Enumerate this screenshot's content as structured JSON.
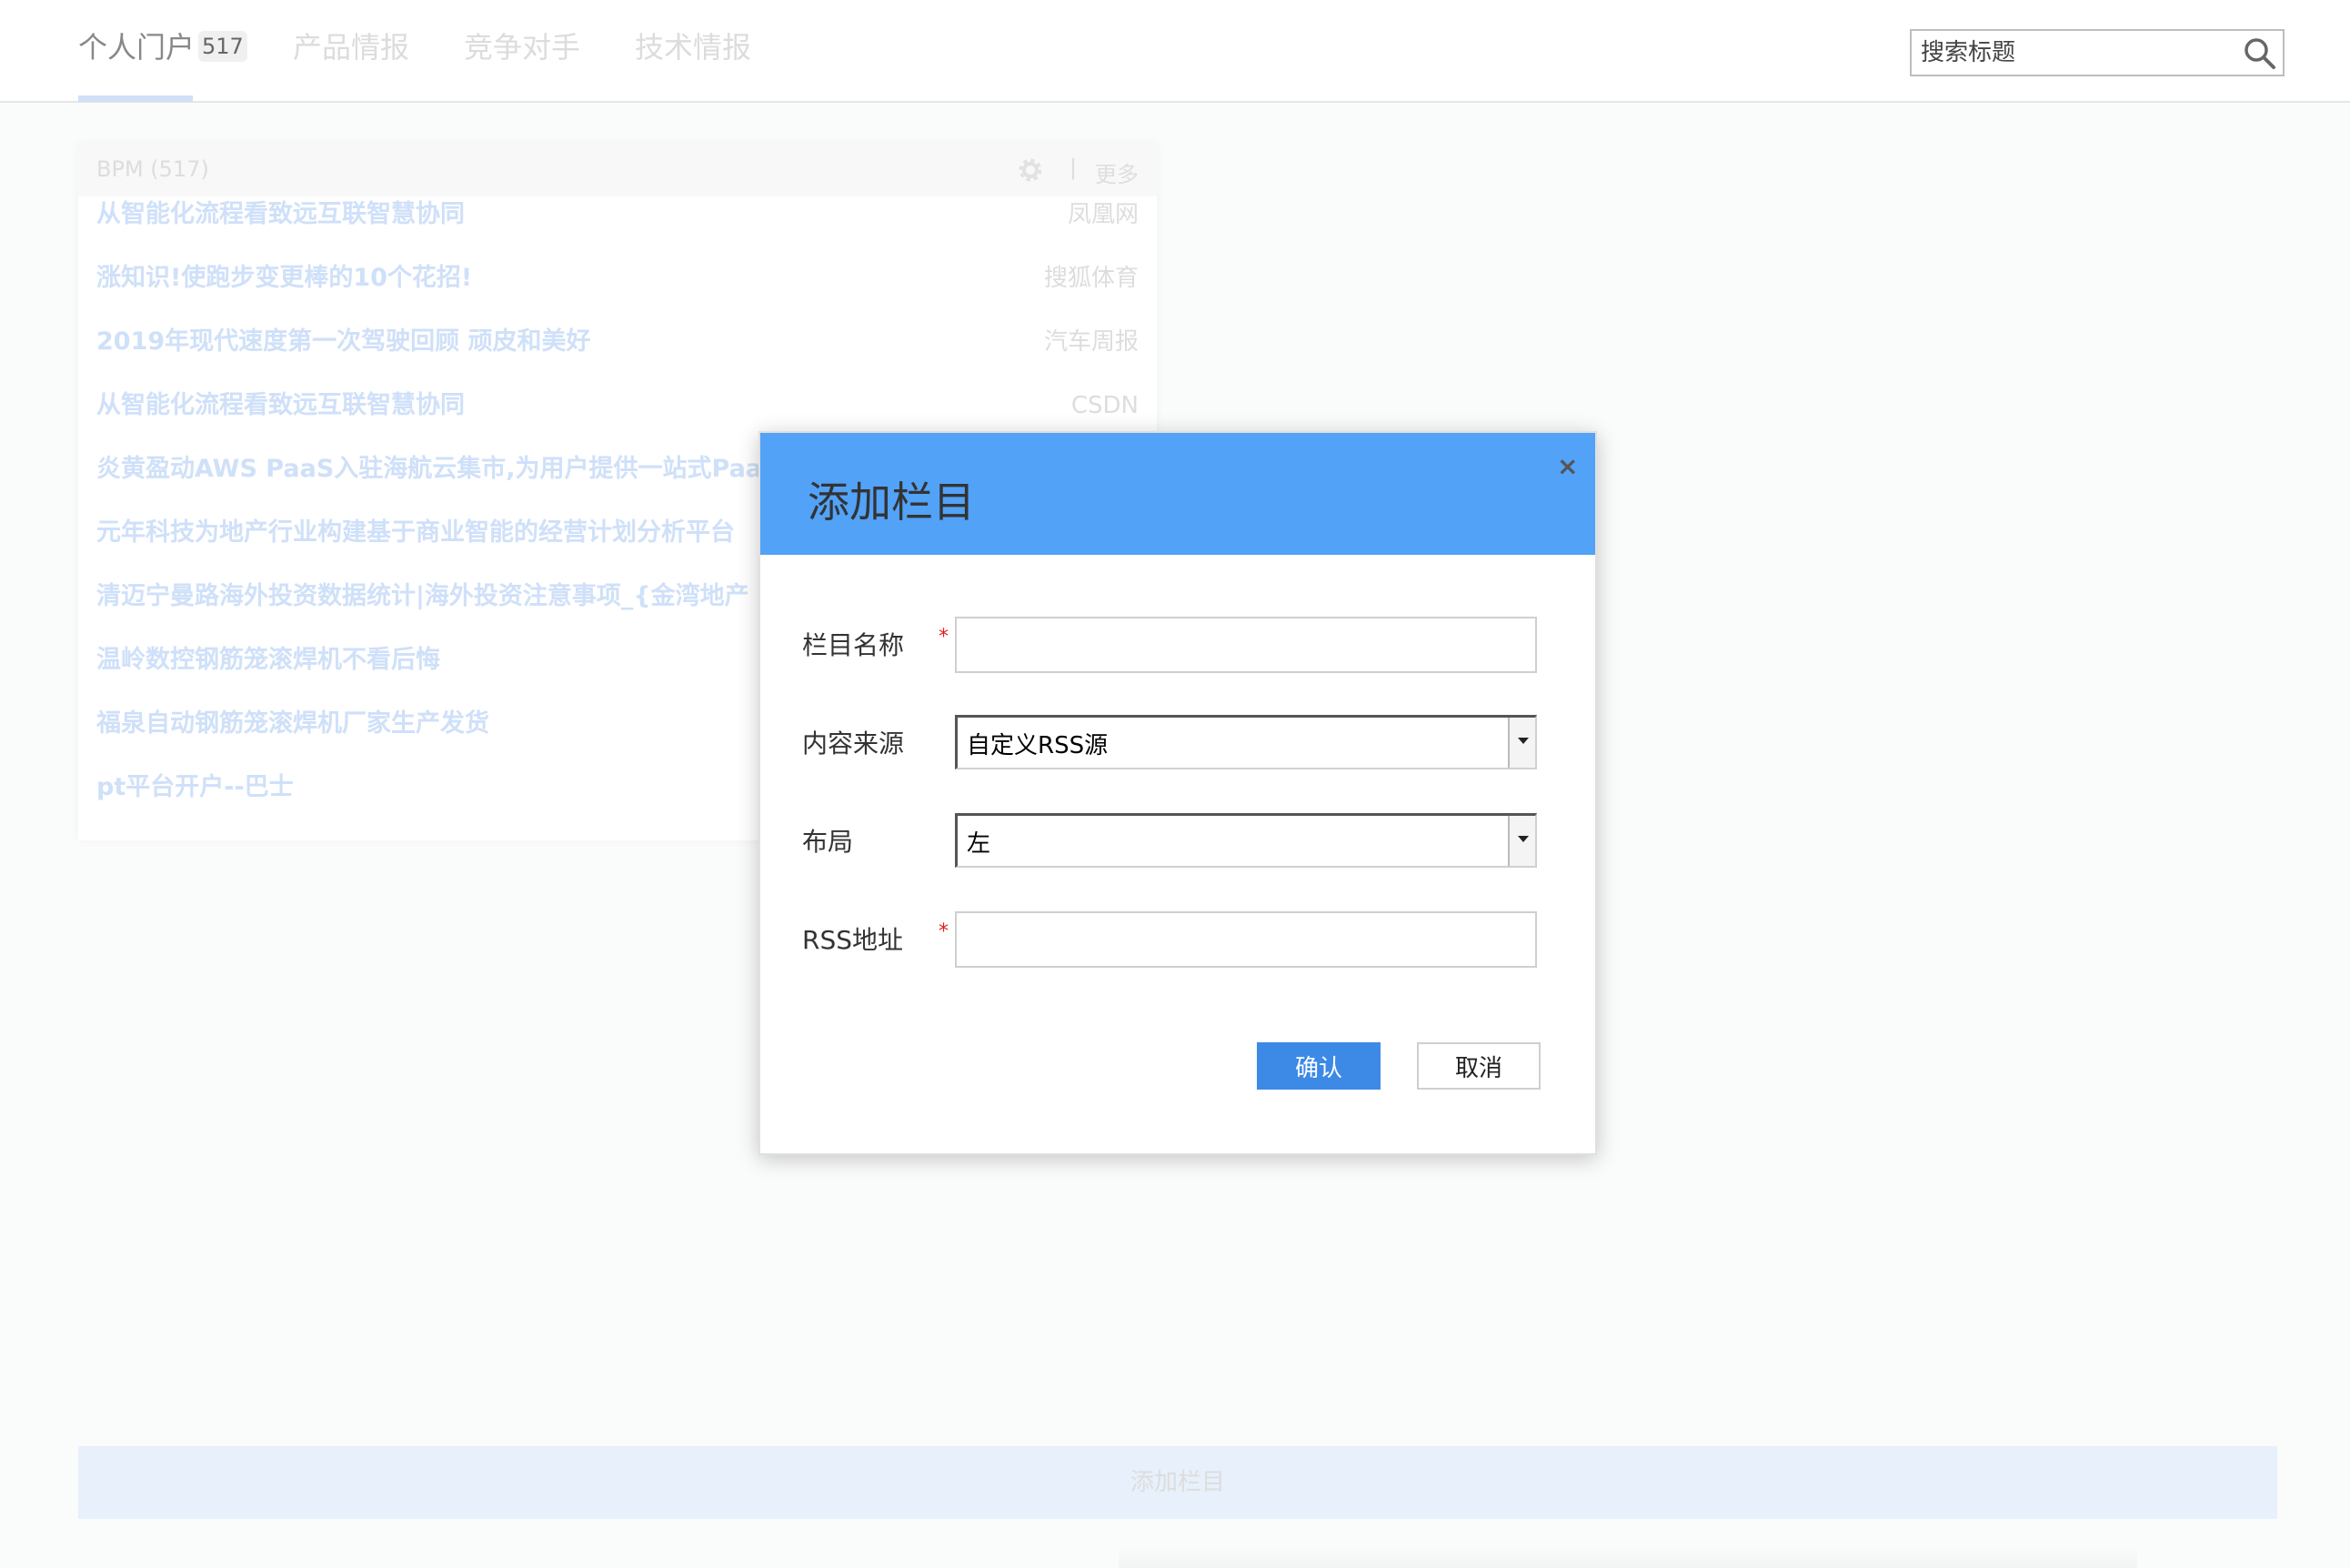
{
  "nav": {
    "tabs": [
      {
        "label": "个人门户",
        "badge": "517"
      },
      {
        "label": "产品情报"
      },
      {
        "label": "竞争对手"
      },
      {
        "label": "技术情报"
      }
    ],
    "search_placeholder": "搜索标题",
    "search_icon": "search-icon"
  },
  "portlet": {
    "title": "BPM (517)",
    "separator": "|",
    "more_label": "更多",
    "settings_icon": "gear-icon",
    "items": [
      {
        "title": "从智能化流程看致远互联智慧协同",
        "source": "凤凰网"
      },
      {
        "title": "涨知识!使跑步变更棒的10个花招!",
        "source": "搜狐体育"
      },
      {
        "title": "2019年现代速度第一次驾驶回顾 顽皮和美好",
        "source": "汽车周报"
      },
      {
        "title": "从智能化流程看致远互联智慧协同",
        "source": "CSDN"
      },
      {
        "title": "炎黄盈动AWS PaaS入驻海航云集市,为用户提供一站式Paa",
        "source": ""
      },
      {
        "title": "元年科技为地产行业构建基于商业智能的经营计划分析平台",
        "source": ""
      },
      {
        "title": "清迈宁曼路海外投资数据统计|海外投资注意事项_{金湾地产",
        "source": ""
      },
      {
        "title": "温岭数控钢筋笼滚焊机不看后悔",
        "source": ""
      },
      {
        "title": "福泉自动钢筋笼滚焊机厂家生产发货",
        "source": ""
      },
      {
        "title": "pt平台开户--巴士",
        "source": ""
      }
    ]
  },
  "add_bar_label": "添加栏目",
  "modal": {
    "title": "添加栏目",
    "close_label": "×",
    "required_mark": "*",
    "fields": {
      "name_label": "栏目名称",
      "name_value": "",
      "source_label": "内容来源",
      "source_value": "自定义RSS源",
      "layout_label": "布局",
      "layout_value": "左",
      "rss_label": "RSS地址",
      "rss_value": ""
    },
    "confirm_label": "确认",
    "cancel_label": "取消"
  },
  "colors": {
    "modal_header": "#52a2f7",
    "confirm_button": "#3d8ae6",
    "required": "#e02020"
  }
}
